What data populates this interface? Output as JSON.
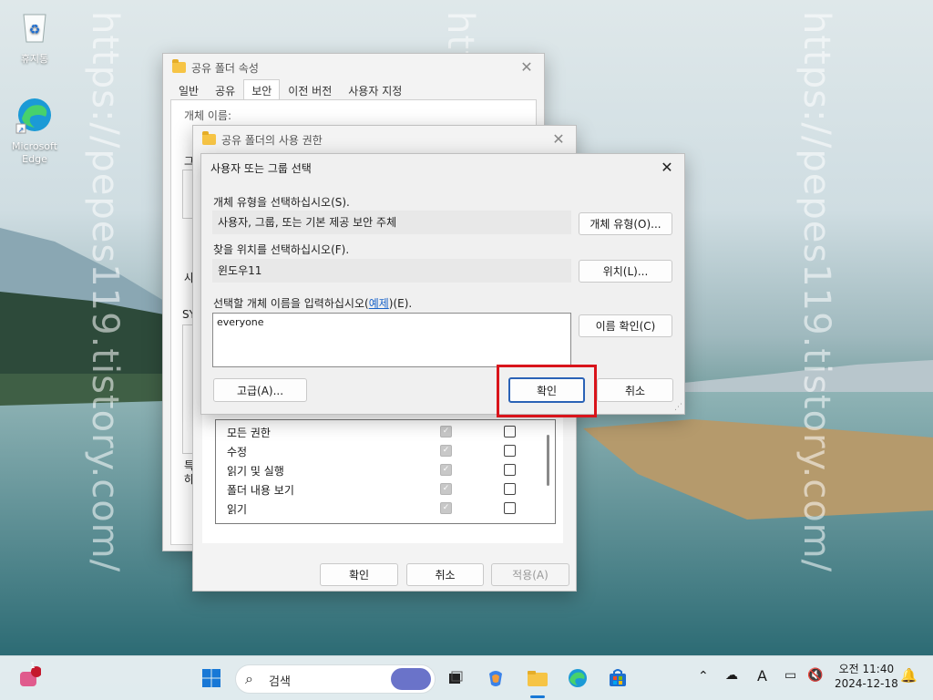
{
  "watermark": "https://pepes119.tistory.com/",
  "desktop": {
    "recycle_bin": "휴지통",
    "edge": "Microsoft Edge"
  },
  "props_window": {
    "title": "공유 폴더 속성",
    "tabs": [
      "일반",
      "공유",
      "보안",
      "이전 버전",
      "사용자 지정"
    ],
    "partial_texts": [
      "개체 이름:",
      "그",
      "사",
      "SY",
      "특",
      "하"
    ]
  },
  "perm_window": {
    "title": "공유 폴더의 사용 권한",
    "permissions": [
      {
        "name": "모든 권한",
        "allow": true,
        "deny": false
      },
      {
        "name": "수정",
        "allow": true,
        "deny": false
      },
      {
        "name": "읽기 및 실행",
        "allow": true,
        "deny": false
      },
      {
        "name": "폴더 내용 보기",
        "allow": true,
        "deny": false
      },
      {
        "name": "읽기",
        "allow": true,
        "deny": false
      }
    ],
    "ok": "확인",
    "cancel": "취소",
    "apply": "적용(A)"
  },
  "select_dialog": {
    "title": "사용자 또는 그룹 선택",
    "object_type_label": "개체 유형을 선택하십시오(S).",
    "object_type_value": "사용자, 그룹, 또는 기본 제공 보안 주체",
    "object_type_button": "개체 유형(O)...",
    "location_label": "찾을 위치를 선택하십시오(F).",
    "location_value": "윈도우11",
    "location_button": "위치(L)...",
    "name_label_prefix": "선택할 개체 이름을 입력하십시오(",
    "name_label_link": "예제",
    "name_label_suffix": ")(E).",
    "name_value": "everyone",
    "check_names_button": "이름 확인(C)",
    "advanced_button": "고급(A)...",
    "ok": "확인",
    "cancel": "취소"
  },
  "taskbar": {
    "search_placeholder": "검색",
    "chat_badge": "1",
    "time": "오전 11:40",
    "date": "2024-12-18",
    "ime": "A"
  },
  "colors": {
    "highlight_box": "#d9141b",
    "accent": "#2a62b6"
  }
}
